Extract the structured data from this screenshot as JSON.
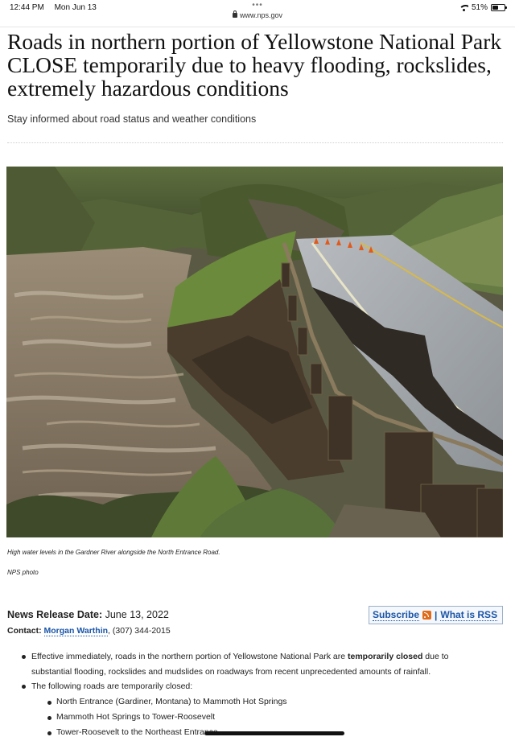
{
  "status_bar": {
    "time": "12:44 PM",
    "date": "Mon Jun 13",
    "dots": "•••",
    "url": "www.nps.gov",
    "battery": "51%",
    "battery_level": 0.51
  },
  "article": {
    "title": "Roads in northern portion of Yellowstone National Park CLOSE temporarily due to heavy flooding, rockslides, extremely hazardous conditions",
    "subtitle": "Stay informed about road status and weather conditions",
    "photo_caption": "High water levels in the Gardner River alongside the North Entrance Road.",
    "photo_credit": "NPS photo"
  },
  "release": {
    "date_label": "News Release Date:",
    "date_value": "June 13, 2022",
    "contact_label": "Contact:",
    "contact_name": "Morgan Warthin",
    "contact_phone": ", (307) 344-2015",
    "subscribe_label": "Subscribe",
    "separator": "|",
    "rss_label": "What is RSS"
  },
  "bullets": {
    "b1_pre": "Effective immediately, roads in the northern portion of Yellowstone National Park are ",
    "b1_bold": "temporarily closed",
    "b1_post": " due to substantial flooding, rockslides and mudslides on roadways from recent unprecedented amounts of rainfall.",
    "b2": "The following roads are temporarily closed:",
    "roads": [
      "North Entrance (Gardiner, Montana) to Mammoth Hot Springs",
      "Mammoth Hot Springs to Tower-Roosevelt",
      "Tower-Roosevelt to the Northeast Entrance"
    ]
  }
}
